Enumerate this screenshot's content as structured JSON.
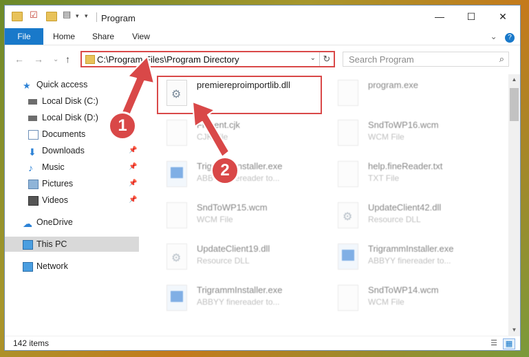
{
  "title_bar": {
    "title": "Program",
    "minimize": "—",
    "maximize": "☐",
    "close": "✕"
  },
  "ribbon": {
    "tabs": [
      "File",
      "Home",
      "Share",
      "View"
    ],
    "expand": "⌄",
    "help": "?"
  },
  "nav": {
    "back": "←",
    "forward": "→",
    "recent": "⌄",
    "up": "↑"
  },
  "address": {
    "path": "C:\\Program Files\\Program Directory",
    "dropdown": "⌄",
    "refresh": "↻"
  },
  "search": {
    "placeholder": "Search Program",
    "icon": "⌕"
  },
  "sidebar": {
    "items": [
      {
        "label": "Quick access",
        "icon": "star-icon"
      },
      {
        "label": "Local Disk (C:)",
        "icon": "drive-icon"
      },
      {
        "label": "Local Disk (D:)",
        "icon": "drive-icon"
      },
      {
        "label": "Documents",
        "icon": "documents-icon"
      },
      {
        "label": "Downloads",
        "icon": "download-icon",
        "pinned": true
      },
      {
        "label": "Music",
        "icon": "music-icon",
        "pinned": true
      },
      {
        "label": "Pictures",
        "icon": "pictures-icon",
        "pinned": true
      },
      {
        "label": "Videos",
        "icon": "videos-icon",
        "pinned": true
      },
      {
        "label": "OneDrive",
        "icon": "cloud-icon"
      },
      {
        "label": "This PC",
        "icon": "computer-icon",
        "selected": true
      },
      {
        "label": "Network",
        "icon": "network-icon"
      }
    ],
    "pin_glyph": "📌"
  },
  "files": [
    {
      "name": "premiereproimportlib.dll",
      "type": "",
      "icon": "gear",
      "highlighted": true
    },
    {
      "name": "program.exe",
      "type": "",
      "icon": "app"
    },
    {
      "name": "Fineent.cjk",
      "type": "CJK File",
      "icon": "doc"
    },
    {
      "name": "SndToWP16.wcm",
      "type": "WCM File",
      "icon": "doc"
    },
    {
      "name": "TrigrammInstaller.exe",
      "type": "ABBYY finereader to...",
      "icon": "win"
    },
    {
      "name": "help.fineReader.txt",
      "type": "TXT File",
      "icon": "doc"
    },
    {
      "name": "SndToWP15.wcm",
      "type": "WCM File",
      "icon": "doc"
    },
    {
      "name": "UpdateClient42.dll",
      "type": "Resource DLL",
      "icon": "gear"
    },
    {
      "name": "UpdateClient19.dll",
      "type": "Resource DLL",
      "icon": "gear"
    },
    {
      "name": "TrigrammInstaller.exe",
      "type": "ABBYY finereader to...",
      "icon": "win"
    },
    {
      "name": "TrigrammInstaller.exe",
      "type": "ABBYY finereader to...",
      "icon": "win"
    },
    {
      "name": "SndToWP14.wcm",
      "type": "WCM File",
      "icon": "doc"
    }
  ],
  "annotations": {
    "badge1": "1",
    "badge2": "2",
    "color": "#d94848"
  },
  "status": {
    "count": "142 items"
  },
  "colors": {
    "accent": "#1979ca",
    "annotation": "#d94848"
  }
}
